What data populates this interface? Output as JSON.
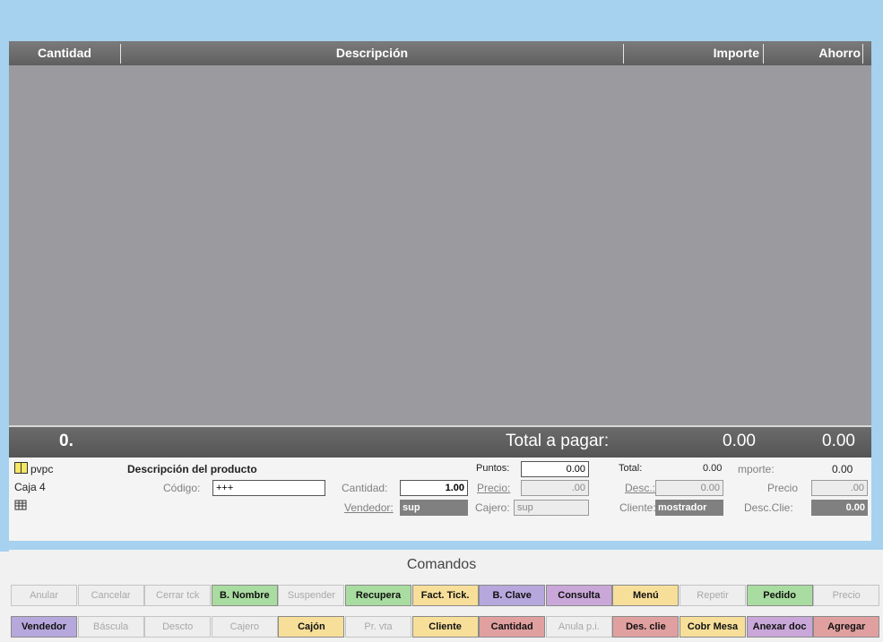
{
  "grid": {
    "headers": [
      "Cantidad",
      "Descripción",
      "Importe",
      "Ahorro"
    ]
  },
  "totals": {
    "count": "0.",
    "label": "Total a pagar:",
    "total": "0.00",
    "savings": "0.00"
  },
  "info": {
    "terminal": "pvpc",
    "caja": "Caja  4",
    "product_desc_label": "Descripción del producto",
    "codigo_label": "Código:",
    "codigo_value": "+++",
    "cantidad_label": "Cantidad:",
    "cantidad_value": "1.00",
    "vendedor_label": "Vendedor:",
    "vendedor_value": "sup",
    "puntos_label": "Puntos:",
    "puntos_value": "0.00",
    "precio_label": "Precio:",
    "precio_value": ".00",
    "cajero_label": "Cajero:",
    "cajero_value": "sup",
    "total_label": "Total:",
    "total_value": "0.00",
    "desc_label": "Desc.:",
    "desc_value": "0.00",
    "cliente_label": "Cliente:",
    "cliente_value": "mostrador",
    "importe_label": "mporte:",
    "importe_value": "0.00",
    "precio2_label": "Precio",
    "precio2_value": ".00",
    "descclie_label": "Desc.Clie:",
    "descclie_value": "0.00"
  },
  "commands": {
    "title": "Comandos",
    "row1": [
      {
        "label": "Anular",
        "active": false,
        "color": ""
      },
      {
        "label": "Cancelar",
        "active": false,
        "color": ""
      },
      {
        "label": "Cerrar tck",
        "active": false,
        "color": ""
      },
      {
        "label": "B. Nombre",
        "active": true,
        "color": "green"
      },
      {
        "label": "Suspender",
        "active": false,
        "color": ""
      },
      {
        "label": "Recupera",
        "active": true,
        "color": "green"
      },
      {
        "label": "Fact. Tick.",
        "active": true,
        "color": "yellow"
      },
      {
        "label": "B. Clave",
        "active": true,
        "color": "purple"
      },
      {
        "label": "Consulta",
        "active": true,
        "color": "violet"
      },
      {
        "label": "Menú",
        "active": true,
        "color": "yellow"
      },
      {
        "label": "Repetir",
        "active": false,
        "color": ""
      },
      {
        "label": "Pedido",
        "active": true,
        "color": "green"
      },
      {
        "label": "Precio",
        "active": false,
        "color": ""
      }
    ],
    "row2": [
      {
        "label": "Vendedor",
        "active": true,
        "color": "purple"
      },
      {
        "label": "Báscula",
        "active": false,
        "color": ""
      },
      {
        "label": "Descto",
        "active": false,
        "color": ""
      },
      {
        "label": "Cajero",
        "active": false,
        "color": ""
      },
      {
        "label": "Cajón",
        "active": true,
        "color": "yellow"
      },
      {
        "label": "Pr. vta",
        "active": false,
        "color": ""
      },
      {
        "label": "Cliente",
        "active": true,
        "color": "yellow"
      },
      {
        "label": "Cantidad",
        "active": true,
        "color": "pink"
      },
      {
        "label": "Anula p.i.",
        "active": false,
        "color": ""
      },
      {
        "label": "Des. clie",
        "active": true,
        "color": "pink"
      },
      {
        "label": "Cobr Mesa",
        "active": true,
        "color": "yellow"
      },
      {
        "label": "Anexar doc",
        "active": true,
        "color": "violet"
      },
      {
        "label": "Agregar",
        "active": true,
        "color": "pink"
      }
    ]
  }
}
